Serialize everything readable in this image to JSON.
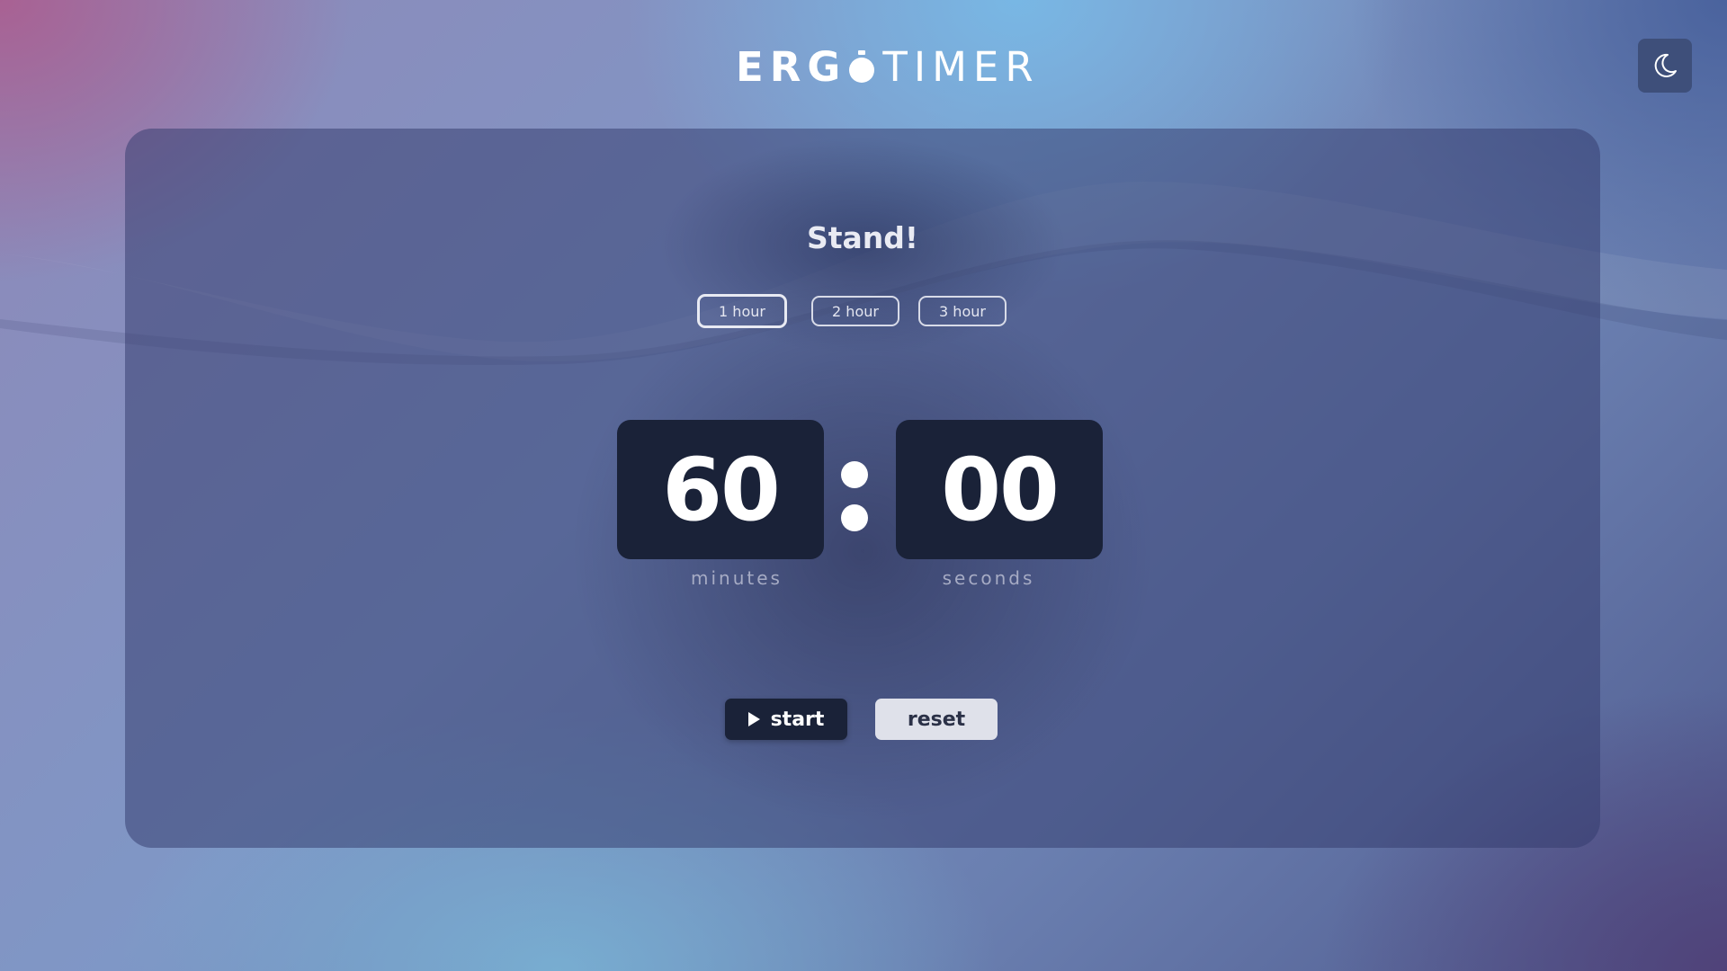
{
  "app": {
    "logo_bold": "ERG",
    "logo_light": "TIMER"
  },
  "header": {
    "theme_toggle_icon": "moon-icon"
  },
  "timer": {
    "heading": "Stand!",
    "presets": [
      {
        "label": "1 hour",
        "active": true
      },
      {
        "label": "2 hour",
        "active": false
      },
      {
        "label": "3 hour",
        "active": false
      }
    ],
    "minutes": "60",
    "seconds": "00",
    "minutes_label": "minutes",
    "seconds_label": "seconds"
  },
  "controls": {
    "start_label": "start",
    "start_icon": "play-icon",
    "reset_label": "reset"
  },
  "colors": {
    "digit_background": "#1a2238",
    "panel_tint": "#343c6e",
    "reset_background": "#dfe1ea"
  }
}
